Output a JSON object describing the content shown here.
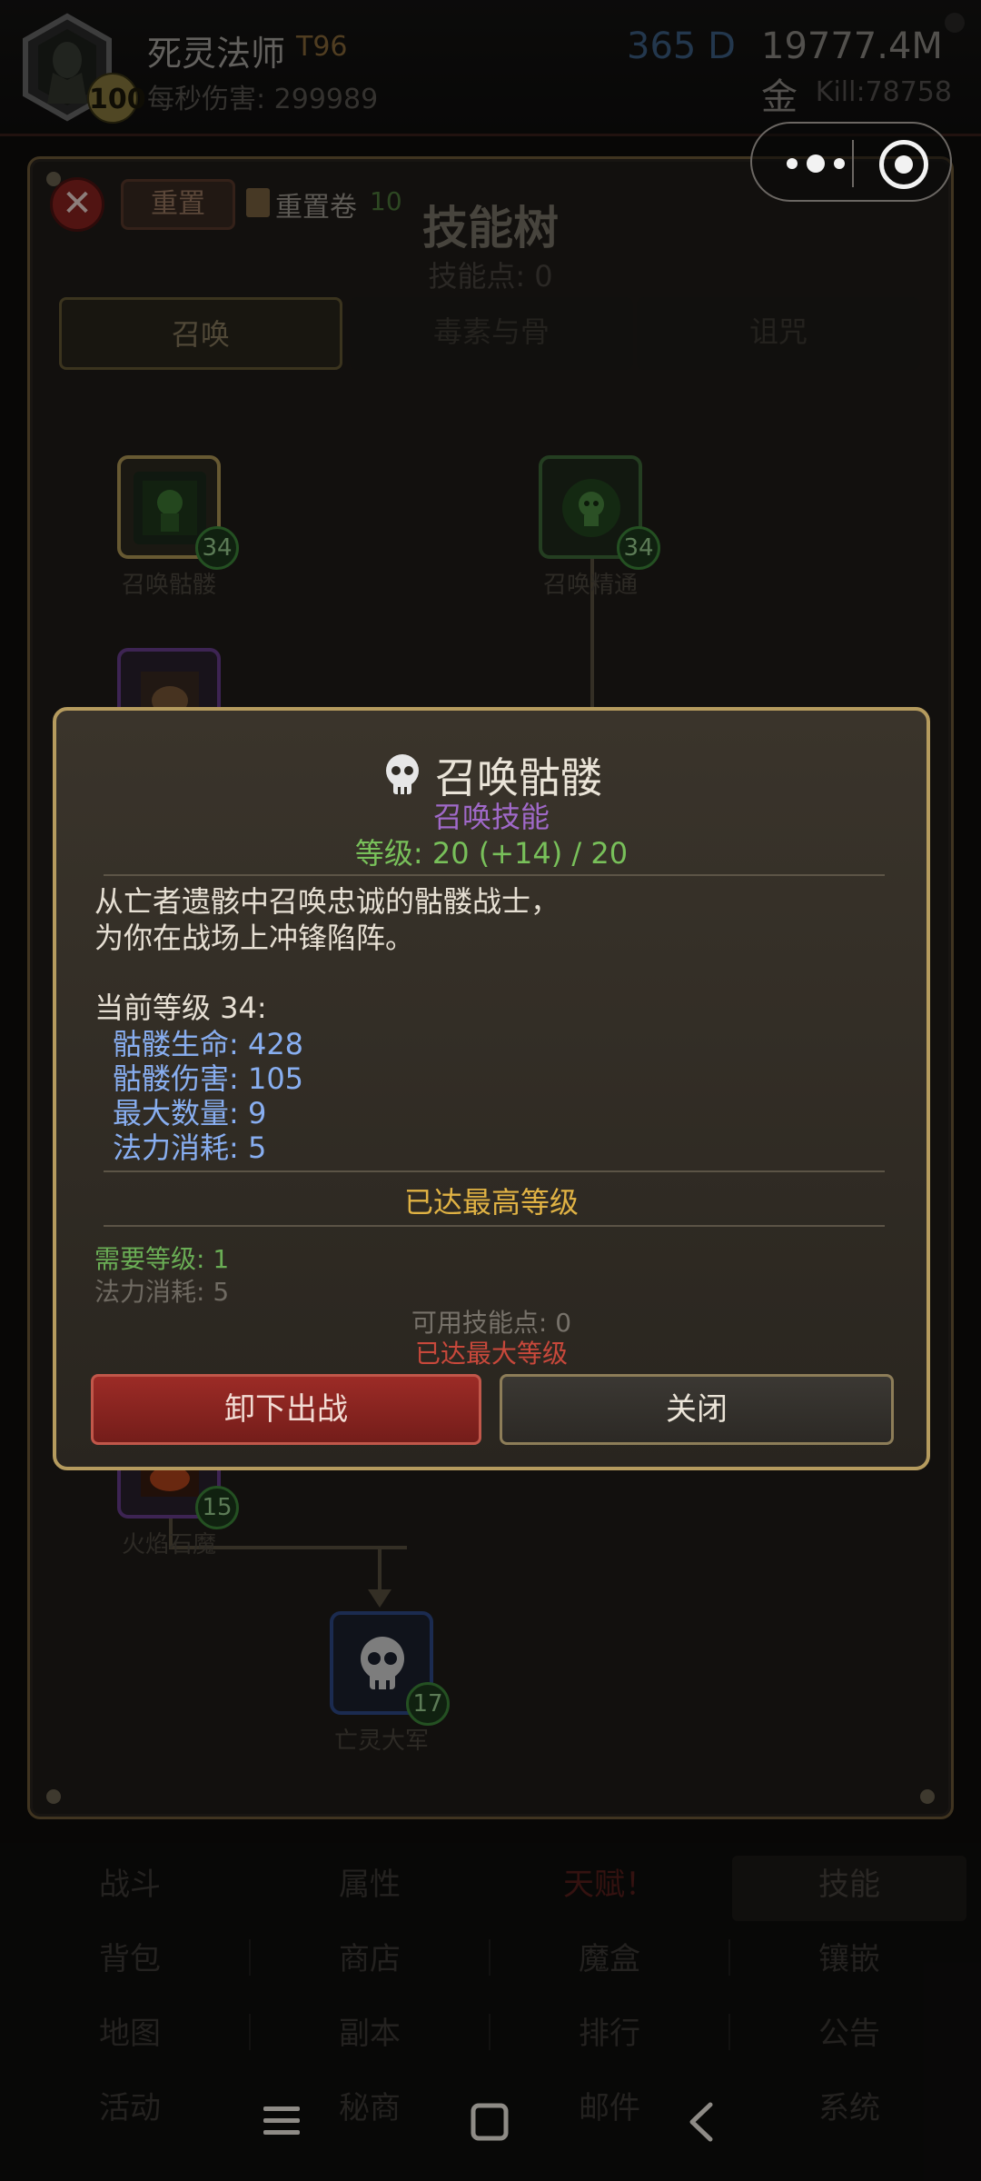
{
  "header": {
    "char_name": "死灵法师",
    "tier": "T96",
    "avatar_level": "100",
    "dps": "每秒伤害: 299989",
    "days": "365 D",
    "gold": "19777.4M 金",
    "kills": "Kill:78758"
  },
  "skill_tree": {
    "reset_label": "重置",
    "scroll_label": "重置卷",
    "scroll_count": "10",
    "title": "技能树",
    "skill_points": "技能点: 0",
    "tabs": [
      {
        "label": "召唤",
        "active": true
      },
      {
        "label": "毒素与骨",
        "active": false
      },
      {
        "label": "诅咒",
        "active": false
      }
    ],
    "nodes": [
      {
        "label": "召唤骷髅",
        "level": "34",
        "icon": "skeleton-icon",
        "color": "#b29a57"
      },
      {
        "label": "召唤精通",
        "level": "34",
        "icon": "skull-sigil-icon",
        "color": "#3f6b3a"
      },
      {
        "label": "",
        "level": "",
        "icon": "beast-icon",
        "color": "#6a3f8f"
      },
      {
        "label": "火焰石魔",
        "level": "15",
        "icon": "fire-golem-icon",
        "color": "#6a3f8f"
      },
      {
        "label": "亡灵大军",
        "level": "17",
        "icon": "skull-icon",
        "color": "#2f4a8a"
      }
    ]
  },
  "popup": {
    "icon": "skull-icon",
    "title": "召唤骷髅",
    "type": "召唤技能",
    "level": "等级: 20 (+14) / 20",
    "desc_line1": "从亡者遗骸中召唤忠诚的骷髅战士，",
    "desc_line2": "为你在战场上冲锋陷阵。",
    "current_level": "当前等级 34:",
    "stats": [
      "骷髅生命: 428",
      "骷髅伤害: 105",
      "最大数量: 9",
      "法力消耗: 5"
    ],
    "maxed_notice": "已达最高等级",
    "required_level": "需要等级: 1",
    "mana_cost": "法力消耗: 5",
    "available_points": "可用技能点: 0",
    "max_level_notice": "已达最大等级",
    "unequip_label": "卸下出战",
    "close_label": "关闭"
  },
  "menu": [
    [
      "战斗",
      "属性",
      "天赋！",
      "技能"
    ],
    [
      "背包",
      "商店",
      "魔盒",
      "镶嵌"
    ],
    [
      "地图",
      "副本",
      "排行",
      "公告"
    ],
    [
      "活动",
      "秘商",
      "邮件",
      "系统"
    ]
  ],
  "menu_colors": {
    "talent": "#5a1f1c",
    "normal": "#3e3b37",
    "active": "#4a4640"
  },
  "nav_icons": [
    "menu-icon",
    "home-square-icon",
    "back-chevron-icon"
  ]
}
